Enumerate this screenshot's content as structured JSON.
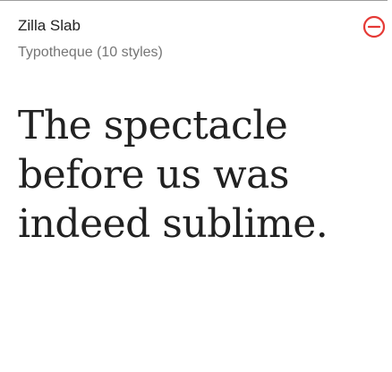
{
  "font_card": {
    "family_name": "Zilla Slab",
    "foundry": "Typotheque",
    "styles_count": "(10 styles)",
    "remove_icon": "minus-circle-icon",
    "accent_color": "#e53935",
    "preview_text": "The spectacle\nbefore us was\nindeed sublime."
  }
}
